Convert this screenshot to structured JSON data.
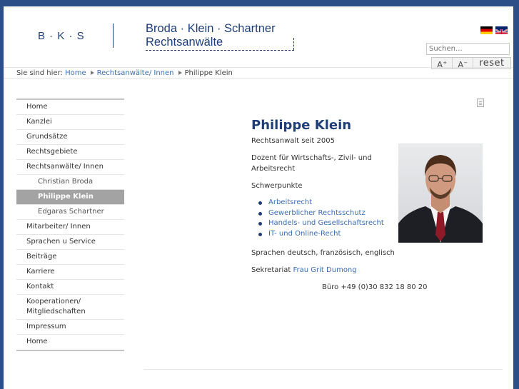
{
  "header": {
    "logo_text": "B · K · S",
    "firm_names": "Broda · Klein · Schartner",
    "firm_subtitle": "Rechtsanwälte",
    "search_placeholder": "Suchen...",
    "font_increase_label": "A",
    "font_decrease_label": "A",
    "reset_label": "reset"
  },
  "breadcrumb": {
    "prefix": "Sie sind hier:",
    "items": [
      "Home",
      "Rechtsanwälte/ Innen",
      "Philippe Klein"
    ]
  },
  "sidebar": {
    "items": [
      {
        "label": "Home"
      },
      {
        "label": "Kanzlei"
      },
      {
        "label": "Grundsätze"
      },
      {
        "label": "Rechtsgebiete"
      },
      {
        "label": "Rechtsanwälte/ Innen"
      },
      {
        "label": "Christian Broda"
      },
      {
        "label": "Philippe Klein"
      },
      {
        "label": "Edgaras Schartner"
      },
      {
        "label": "Mitarbeiter/ Innen"
      },
      {
        "label": "Sprachen u Service"
      },
      {
        "label": "Beiträge"
      },
      {
        "label": "Karriere"
      },
      {
        "label": "Kontakt"
      },
      {
        "label": "Kooperationen/ Mitgliedschaften"
      },
      {
        "label": "Impressum"
      },
      {
        "label": "Home"
      }
    ]
  },
  "content": {
    "name": "Philippe Klein",
    "title": "Rechtsanwalt seit 2005",
    "dozent": "Dozent für Wirtschafts-, Zivil- und Arbeitsrecht",
    "focus_heading": "Schwerpunkte",
    "focus_areas": [
      "Arbeitsrecht",
      "Gewerblicher Rechtsschutz",
      "Handels- und Gesellschaftsrecht",
      "IT- und Online-Recht"
    ],
    "languages": "Sprachen deutsch, französisch, englisch",
    "secretariat_label": "Sekretariat",
    "secretariat_name": "Frau Grit Dumong",
    "office_phone": "Büro +49 (0)30 832 18 80 20"
  },
  "colors": {
    "brand": "#1f3e78",
    "link": "#3b6db3",
    "outer_background": "#2d4f88",
    "active_nav": "#a3a3a3"
  }
}
